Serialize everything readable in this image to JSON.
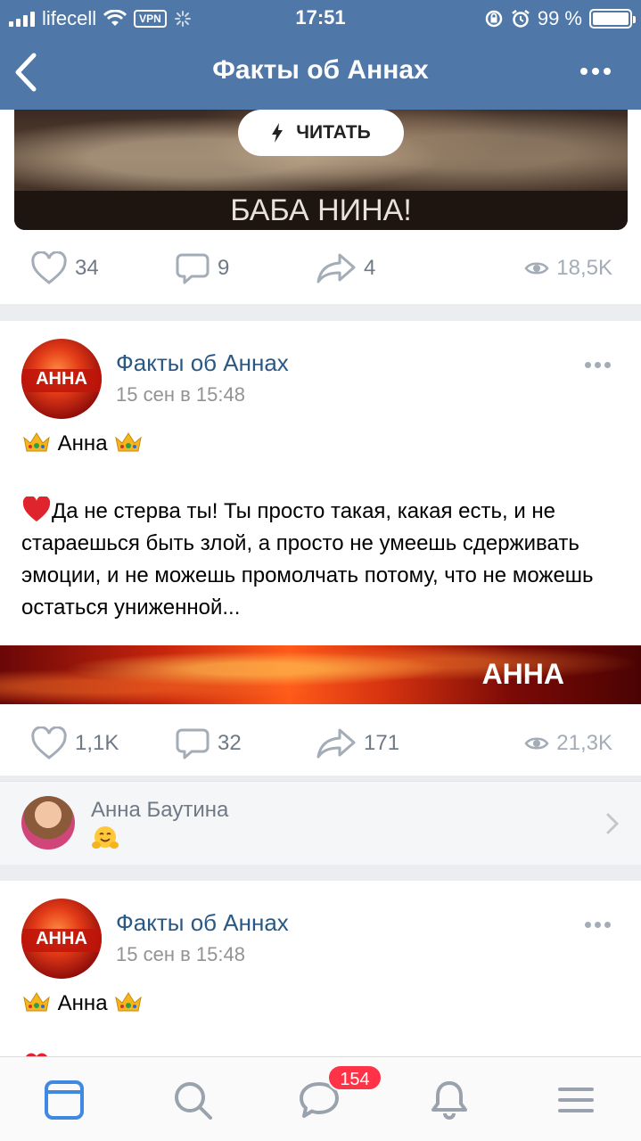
{
  "status_bar": {
    "carrier": "lifecell",
    "vpn": "VPN",
    "time": "17:51",
    "battery": "99 %",
    "battery_level": 0.99
  },
  "nav": {
    "title": "Факты об Аннах"
  },
  "post1": {
    "banner_caption": "БАБА НИНА!",
    "read_label": "ЧИТАТЬ",
    "likes": "34",
    "comments": "9",
    "shares": "4",
    "views": "18,5K"
  },
  "post2": {
    "author": "Факты об Аннах",
    "avatar_label": "АННА",
    "date": "15 сен в 15:48",
    "line1": "Анна",
    "body": "Да не стерва ты! Ты просто такая, какая есть, и не стараешься быть злой, а просто не умеешь сдерживать эмоции, и не можешь промолчать потому, что не можешь остаться униженной...",
    "banner_label": "АННА",
    "likes": "1,1K",
    "comments": "32",
    "shares": "171",
    "views": "21,3K"
  },
  "comment_preview": {
    "author": "Анна Баутина"
  },
  "post3": {
    "author": "Факты об Аннах",
    "avatar_label": "АННА",
    "date": "15 сен в 15:48",
    "line1": "Анна"
  },
  "tabbar": {
    "badge": "154"
  },
  "colors": {
    "header": "#4f77a7",
    "link": "#2a5885",
    "badge": "#ff3347",
    "tab_active": "#3f8ae0"
  }
}
